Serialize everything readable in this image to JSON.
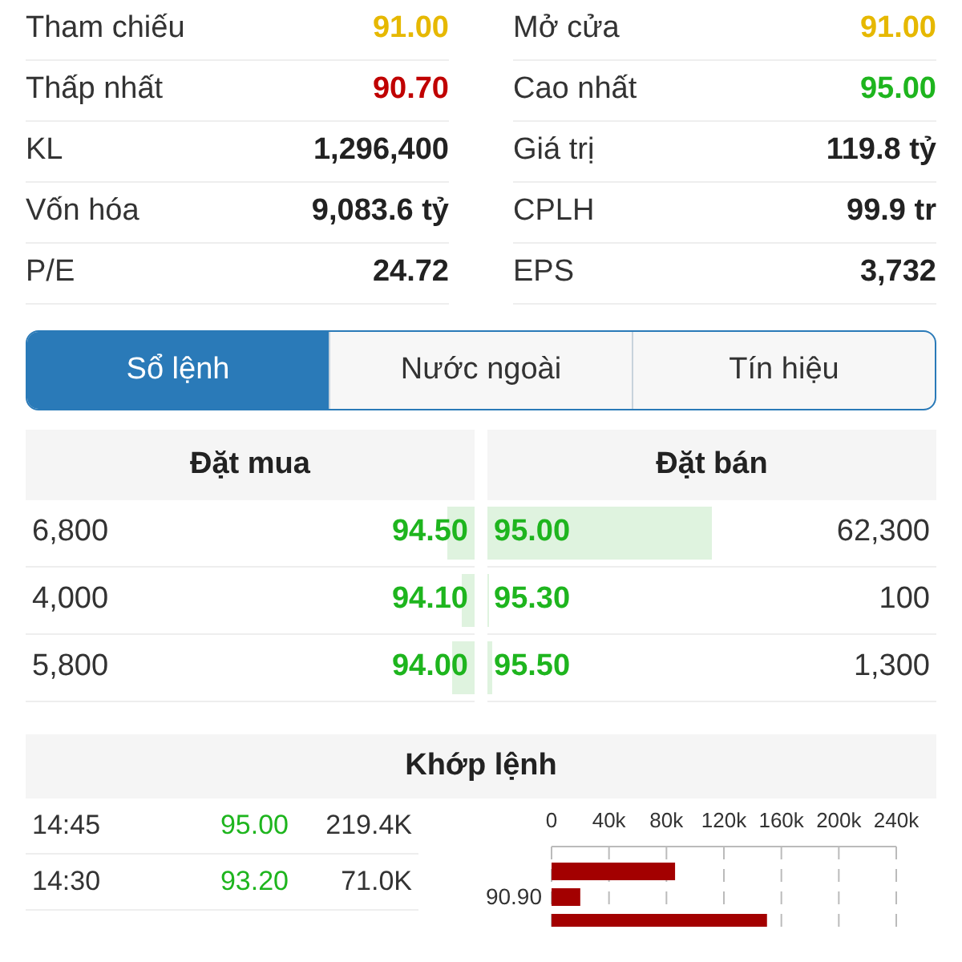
{
  "stats": [
    {
      "left": {
        "label": "Tham chiếu",
        "value": "91.00",
        "color": "#e6b800"
      },
      "right": {
        "label": "Mở cửa",
        "value": "91.00",
        "color": "#e6b800"
      }
    },
    {
      "left": {
        "label": "Thấp nhất",
        "value": "90.70",
        "color": "#c00000"
      },
      "right": {
        "label": "Cao nhất",
        "value": "95.00",
        "color": "#1eb51e"
      }
    },
    {
      "left": {
        "label": "KL",
        "value": "1,296,400",
        "color": "#222222"
      },
      "right": {
        "label": "Giá trị",
        "value": "119.8 tỷ",
        "color": "#222222"
      }
    },
    {
      "left": {
        "label": "Vốn hóa",
        "value": "9,083.6 tỷ",
        "color": "#222222"
      },
      "right": {
        "label": "CPLH",
        "value": "99.9 tr",
        "color": "#222222"
      }
    },
    {
      "left": {
        "label": "P/E",
        "value": "24.72",
        "color": "#222222"
      },
      "right": {
        "label": "EPS",
        "value": "3,732",
        "color": "#222222"
      }
    }
  ],
  "tabs": [
    {
      "label": "Sổ lệnh",
      "selected": true
    },
    {
      "label": "Nước ngoài",
      "selected": false
    },
    {
      "label": "Tín hiệu",
      "selected": false
    }
  ],
  "order_book": {
    "bid_title": "Đặt mua",
    "ask_title": "Đặt bán",
    "rows": [
      {
        "bid": {
          "volume": "6,800",
          "price": "94.50",
          "level": 0.06
        },
        "ask": {
          "price": "95.00",
          "volume": "62,300",
          "level": 0.5
        }
      },
      {
        "bid": {
          "volume": "4,000",
          "price": "94.10",
          "level": 0.03
        },
        "ask": {
          "price": "95.30",
          "volume": "100",
          "level": 0.005
        }
      },
      {
        "bid": {
          "volume": "5,800",
          "price": "94.00",
          "level": 0.05
        },
        "ask": {
          "price": "95.50",
          "volume": "1,300",
          "level": 0.01
        }
      }
    ]
  },
  "matches": {
    "title": "Khớp lệnh",
    "rows": [
      {
        "time": "14:45",
        "price": "95.00",
        "volume": "219.4K"
      },
      {
        "time": "14:30",
        "price": "93.20",
        "volume": "71.0K"
      }
    ],
    "chart_data": {
      "type": "bar",
      "orientation": "horizontal",
      "grid": true,
      "categories": [
        null,
        "90.90",
        null
      ],
      "series": [
        {
          "color": "#a30000",
          "values": [
            86000,
            20000,
            150000
          ]
        }
      ],
      "xlim": [
        0,
        240000
      ],
      "xticks": [
        {
          "value": 0,
          "label": "0"
        },
        {
          "value": 40000,
          "label": "40k"
        },
        {
          "value": 80000,
          "label": "80k"
        },
        {
          "value": 120000,
          "label": "120k"
        },
        {
          "value": 160000,
          "label": "160k"
        },
        {
          "value": 200000,
          "label": "200k"
        },
        {
          "value": 240000,
          "label": "240k"
        }
      ]
    }
  }
}
